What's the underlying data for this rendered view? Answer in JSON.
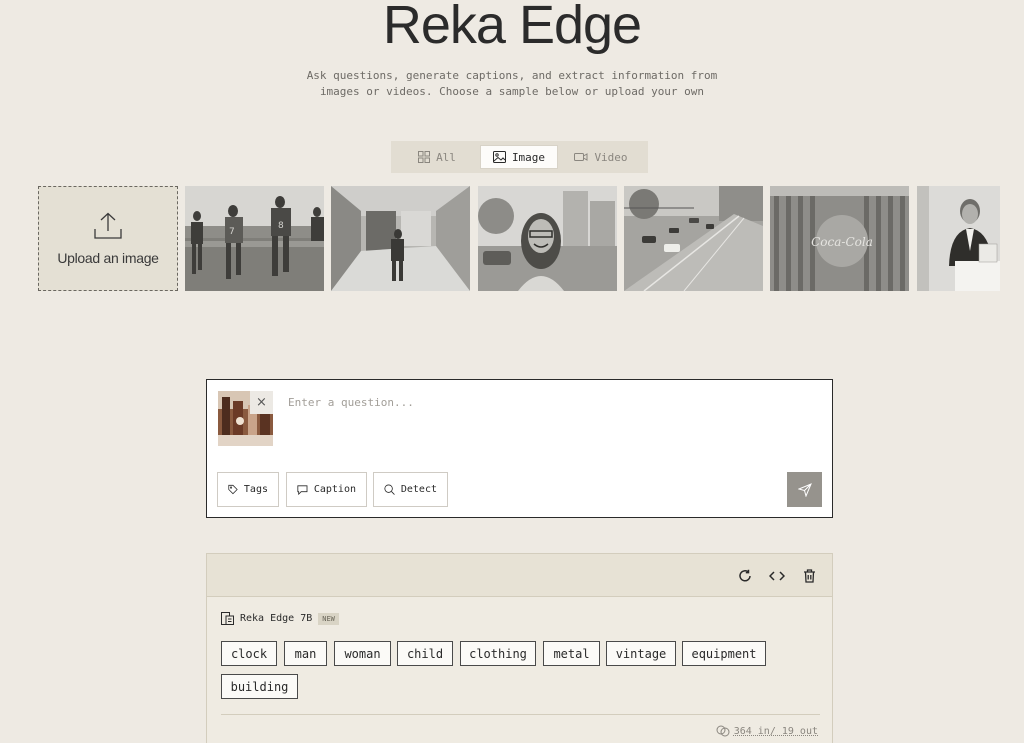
{
  "header": {
    "title": "Reka Edge",
    "subtitle_line1": "Ask questions, generate captions, and extract information from",
    "subtitle_line2": "images or videos. Choose a sample below or upload your own"
  },
  "filters": {
    "all": "All",
    "image": "Image",
    "video": "Video",
    "selected": "Image"
  },
  "gallery": {
    "upload_label": "Upload an image",
    "samples": [
      {
        "name": "sample-soccer-players"
      },
      {
        "name": "sample-office-corridor"
      },
      {
        "name": "sample-smiling-woman"
      },
      {
        "name": "sample-street-traffic"
      },
      {
        "name": "sample-coca-cola-sign"
      },
      {
        "name": "sample-businessman"
      }
    ]
  },
  "composer": {
    "placeholder": "Enter a question...",
    "actions": {
      "tags": "Tags",
      "caption": "Caption",
      "detect": "Detect"
    },
    "close_glyph": "×"
  },
  "result": {
    "model_name": "Reka Edge 7B",
    "badge": "NEW",
    "tags": [
      "clock",
      "man",
      "woman",
      "child",
      "clothing",
      "metal",
      "vintage",
      "equipment",
      "building"
    ],
    "usage": "364 in/ 19 out"
  },
  "icons": {
    "filter_all": "grid-icon",
    "filter_image": "image-icon",
    "filter_video": "video-icon",
    "upload": "upload-icon",
    "tags": "tag-icon",
    "caption": "message-icon",
    "detect": "search-icon",
    "send": "send-icon",
    "refresh": "refresh-icon",
    "code": "code-icon",
    "delete": "trash-icon",
    "model": "model-icon",
    "usage": "coins-icon"
  }
}
